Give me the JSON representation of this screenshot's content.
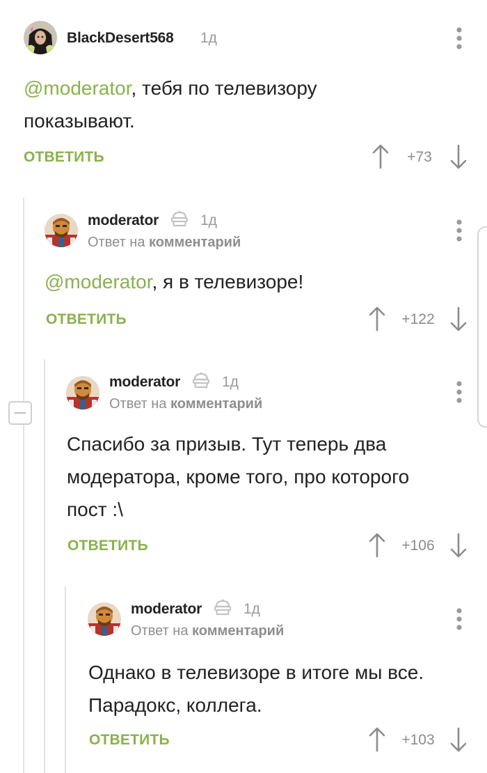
{
  "comments": [
    {
      "username": "BlackDesert568",
      "time": "1д",
      "mention": "@moderator",
      "text_after_mention": ", тебя по телевизору",
      "text_line2": "показывают.",
      "reply_label": "ОТВЕТИТЬ",
      "rating": "+73"
    },
    {
      "username": "moderator",
      "time": "1д",
      "reply_prefix": "Ответ на",
      "reply_target": "комментарий",
      "mention": "@moderator",
      "text_after_mention": ", я в телевизоре!",
      "reply_label": "ОТВЕТИТЬ",
      "rating": "+122"
    },
    {
      "username": "moderator",
      "time": "1д",
      "reply_prefix": "Ответ на",
      "reply_target": "комментарий",
      "text_line1": "Спасибо за призыв. Тут теперь два",
      "text_line2": "модератора, кроме того, про которого",
      "text_line3": "пост :\\",
      "reply_label": "ОТВЕТИТЬ",
      "rating": "+106"
    },
    {
      "username": "moderator",
      "time": "1д",
      "reply_prefix": "Ответ на",
      "reply_target": "комментарий",
      "text_line1": "Однако в телевизоре в итоге мы все.",
      "text_line2": "Парадокс, коллега.",
      "reply_label": "ОТВЕТИТЬ",
      "rating": "+103"
    }
  ],
  "icons": {
    "upvote": "arrow-up-icon",
    "downvote": "arrow-down-icon",
    "more": "more-vertical-icon",
    "moderator_badge": "moderator-cake-icon",
    "collapse": "collapse-minus-icon"
  },
  "colors": {
    "accent_green": "#8ab14c",
    "text": "#222222",
    "muted": "#9a9a9a",
    "thread_line": "#e3e3e3"
  }
}
